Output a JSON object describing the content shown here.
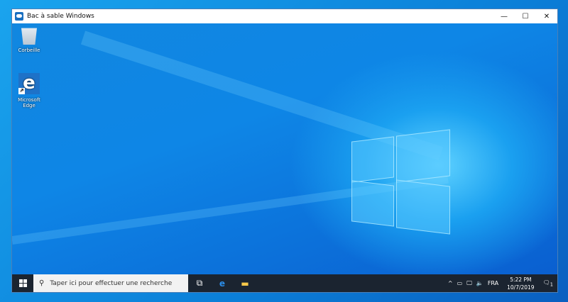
{
  "window": {
    "title": "Bac à sable Windows",
    "minimize": "—",
    "maximize": "☐",
    "close": "✕"
  },
  "desktop": {
    "icons": [
      {
        "label": "Corbeille",
        "icon": "recycle-bin-icon"
      },
      {
        "label": "Microsoft Edge",
        "icon": "edge-icon"
      }
    ]
  },
  "taskbar": {
    "search_placeholder": "Taper ici pour effectuer une recherche",
    "tray": {
      "chevron": "^",
      "language": "FRA",
      "time": "5:22 PM",
      "date": "10/7/2019",
      "notifications": "1"
    }
  },
  "colors": {
    "taskbar": "#1b2430",
    "accent": "#0b7fd8"
  }
}
